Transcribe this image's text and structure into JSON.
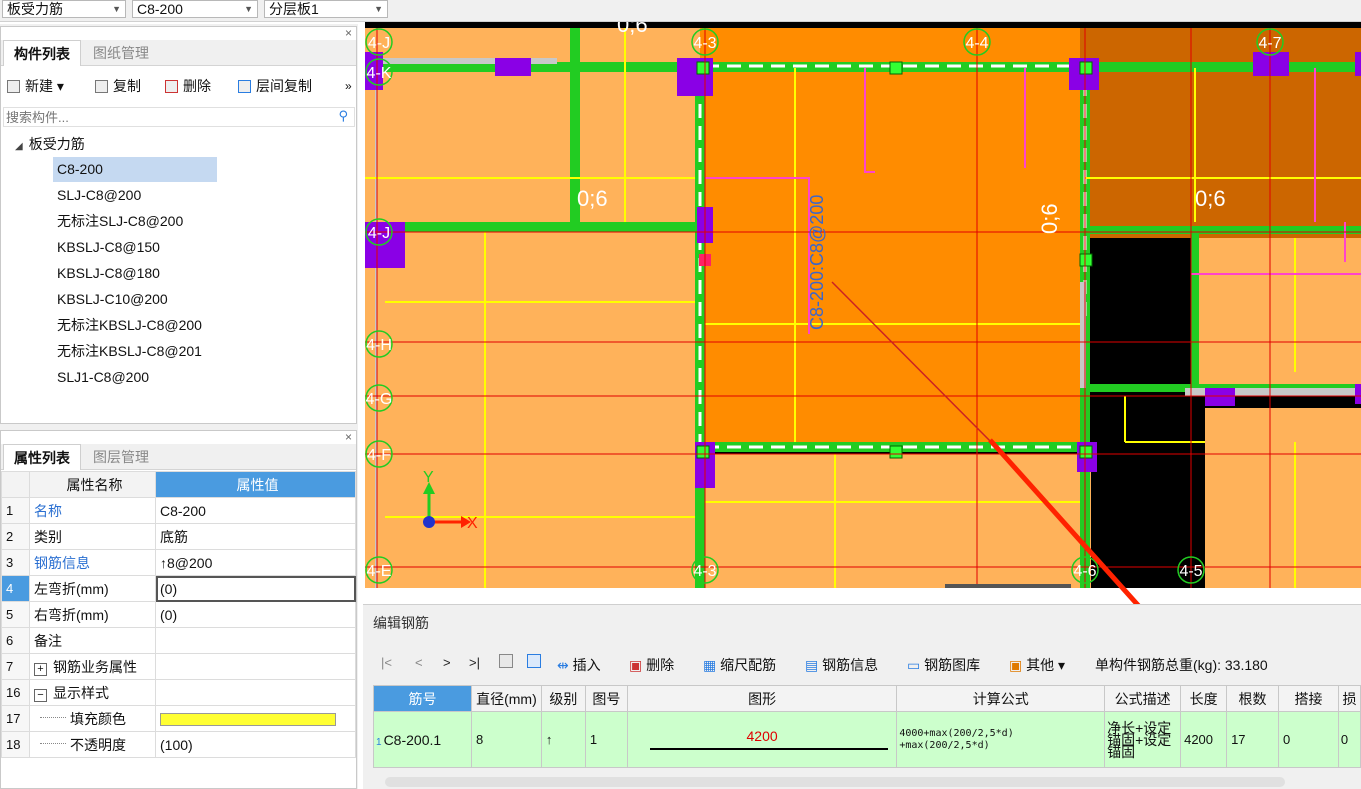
{
  "top": {
    "combo1": "板受力筋",
    "combo2": "C8-200",
    "combo3": "分层板1"
  },
  "component_panel": {
    "tabs": [
      "构件列表",
      "图纸管理"
    ],
    "toolbar": {
      "new": "新建",
      "copy": "复制",
      "delete": "删除",
      "floor_copy": "层间复制",
      "more": "»"
    },
    "search_placeholder": "搜索构件...",
    "tree_root": "板受力筋",
    "items": [
      "C8-200",
      "SLJ-C8@200",
      "无标注SLJ-C8@200",
      "KBSLJ-C8@150",
      "KBSLJ-C8@180",
      "KBSLJ-C10@200",
      "无标注KBSLJ-C8@200",
      "无标注KBSLJ-C8@201",
      "SLJ1-C8@200"
    ],
    "selected_index": 0
  },
  "property_panel": {
    "tabs": [
      "属性列表",
      "图层管理"
    ],
    "header": {
      "name": "属性名称",
      "value": "属性值"
    },
    "rows": [
      {
        "n": "1",
        "name": "名称",
        "value": "C8-200",
        "blue": true
      },
      {
        "n": "2",
        "name": "类别",
        "value": "底筋",
        "blue": false
      },
      {
        "n": "3",
        "name": "钢筋信息",
        "value": "↑8@200",
        "blue": true
      },
      {
        "n": "4",
        "name": "左弯折(mm)",
        "value": "(0)",
        "blue": false
      },
      {
        "n": "5",
        "name": "右弯折(mm)",
        "value": "(0)",
        "blue": false
      },
      {
        "n": "6",
        "name": "备注",
        "value": "",
        "blue": false
      },
      {
        "n": "7",
        "name": "钢筋业务属性",
        "value": "",
        "blue": false,
        "expander": "+"
      },
      {
        "n": "16",
        "name": "显示样式",
        "value": "",
        "blue": false,
        "expander": "−"
      },
      {
        "n": "17",
        "name": "填充颜色",
        "value": "",
        "blue": false,
        "child": true,
        "color": "#ffff33"
      },
      {
        "n": "18",
        "name": "不透明度",
        "value": "(100)",
        "blue": false,
        "child": true
      }
    ],
    "selected_row": "4"
  },
  "canvas": {
    "axis_labels": [
      "4-J",
      "4-K",
      "4-3",
      "4-4",
      "4-7",
      "4-J",
      "4-H",
      "4-G",
      "4-F",
      "4-E",
      "4-3",
      "4-6",
      "4-5"
    ],
    "annotations": [
      "0;6",
      "0;6",
      "0;6",
      "0;6",
      "C8-200:C8@200"
    ],
    "axis_x": "X",
    "axis_y": "Y"
  },
  "editor": {
    "title": "编辑钢筋",
    "nav": [
      "|<",
      "<",
      ">",
      ">|"
    ],
    "actions": [
      "插入",
      "删除",
      "缩尺配筋",
      "钢筋信息",
      "钢筋图库",
      "其他"
    ],
    "total_label": "单构件钢筋总重(kg): 33.180",
    "columns": [
      "筋号",
      "直径(mm)",
      "级别",
      "图号",
      "图形",
      "计算公式",
      "公式描述",
      "长度",
      "根数",
      "搭接",
      "损"
    ],
    "row": {
      "n": "1",
      "bar_no": "C8-200.1",
      "diameter": "8",
      "grade": "↑",
      "fig_no": "1",
      "shape_value": "4200",
      "formula_line1": "4000+max(200/2,5*d)",
      "formula_line2": "+max(200/2,5*d)",
      "desc_line1": "净长+设定",
      "desc_line2": "锚固+设定",
      "desc_line3": "锚固",
      "length": "4200",
      "count": "17",
      "lap": "0",
      "loss": "0"
    }
  },
  "colors": {
    "plate_orange": "#ffb25a",
    "plate_dark_orange": "#ff8c00",
    "plate_brown": "#cc6600",
    "beam_green": "#22cc22",
    "column_purple": "#8a00e6",
    "rebar_yellow": "#ffff00",
    "rebar_pink": "#ff44cc",
    "arrow_red": "#ff2200",
    "selected_blue": "#c5d9f1",
    "header_blue": "#4a9be0",
    "row_green": "#ccffcc"
  }
}
